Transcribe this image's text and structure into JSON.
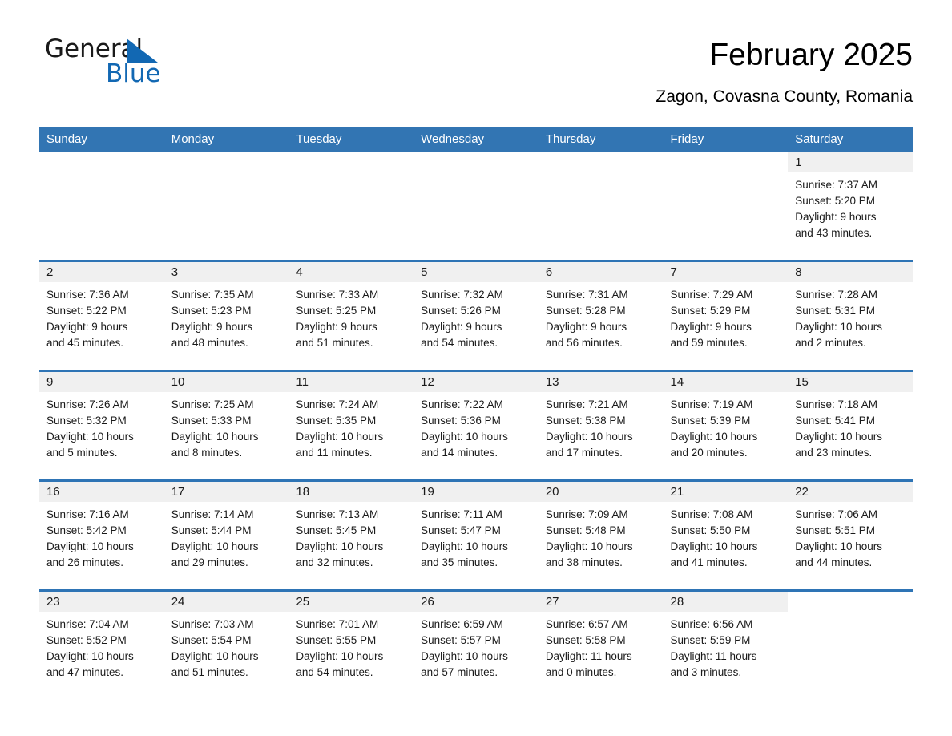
{
  "brand": {
    "name_part1": "General",
    "name_part2": "Blue",
    "logo_icon": "triangle-icon",
    "accent_color": "#1268b3"
  },
  "header": {
    "title": "February 2025",
    "subtitle": "Zagon, Covasna County, Romania"
  },
  "calendar": {
    "header_bg": "#3275b3",
    "row_border_color": "#2e74b5",
    "daynum_bg": "#f0f0f0",
    "weekdays": [
      "Sunday",
      "Monday",
      "Tuesday",
      "Wednesday",
      "Thursday",
      "Friday",
      "Saturday"
    ],
    "weeks": [
      [
        {
          "day": "",
          "blank": true
        },
        {
          "day": "",
          "blank": true
        },
        {
          "day": "",
          "blank": true
        },
        {
          "day": "",
          "blank": true
        },
        {
          "day": "",
          "blank": true
        },
        {
          "day": "",
          "blank": true
        },
        {
          "day": "1",
          "sunrise": "Sunrise: 7:37 AM",
          "sunset": "Sunset: 5:20 PM",
          "daylight1": "Daylight: 9 hours",
          "daylight2": "and 43 minutes."
        }
      ],
      [
        {
          "day": "2",
          "sunrise": "Sunrise: 7:36 AM",
          "sunset": "Sunset: 5:22 PM",
          "daylight1": "Daylight: 9 hours",
          "daylight2": "and 45 minutes."
        },
        {
          "day": "3",
          "sunrise": "Sunrise: 7:35 AM",
          "sunset": "Sunset: 5:23 PM",
          "daylight1": "Daylight: 9 hours",
          "daylight2": "and 48 minutes."
        },
        {
          "day": "4",
          "sunrise": "Sunrise: 7:33 AM",
          "sunset": "Sunset: 5:25 PM",
          "daylight1": "Daylight: 9 hours",
          "daylight2": "and 51 minutes."
        },
        {
          "day": "5",
          "sunrise": "Sunrise: 7:32 AM",
          "sunset": "Sunset: 5:26 PM",
          "daylight1": "Daylight: 9 hours",
          "daylight2": "and 54 minutes."
        },
        {
          "day": "6",
          "sunrise": "Sunrise: 7:31 AM",
          "sunset": "Sunset: 5:28 PM",
          "daylight1": "Daylight: 9 hours",
          "daylight2": "and 56 minutes."
        },
        {
          "day": "7",
          "sunrise": "Sunrise: 7:29 AM",
          "sunset": "Sunset: 5:29 PM",
          "daylight1": "Daylight: 9 hours",
          "daylight2": "and 59 minutes."
        },
        {
          "day": "8",
          "sunrise": "Sunrise: 7:28 AM",
          "sunset": "Sunset: 5:31 PM",
          "daylight1": "Daylight: 10 hours",
          "daylight2": "and 2 minutes."
        }
      ],
      [
        {
          "day": "9",
          "sunrise": "Sunrise: 7:26 AM",
          "sunset": "Sunset: 5:32 PM",
          "daylight1": "Daylight: 10 hours",
          "daylight2": "and 5 minutes."
        },
        {
          "day": "10",
          "sunrise": "Sunrise: 7:25 AM",
          "sunset": "Sunset: 5:33 PM",
          "daylight1": "Daylight: 10 hours",
          "daylight2": "and 8 minutes."
        },
        {
          "day": "11",
          "sunrise": "Sunrise: 7:24 AM",
          "sunset": "Sunset: 5:35 PM",
          "daylight1": "Daylight: 10 hours",
          "daylight2": "and 11 minutes."
        },
        {
          "day": "12",
          "sunrise": "Sunrise: 7:22 AM",
          "sunset": "Sunset: 5:36 PM",
          "daylight1": "Daylight: 10 hours",
          "daylight2": "and 14 minutes."
        },
        {
          "day": "13",
          "sunrise": "Sunrise: 7:21 AM",
          "sunset": "Sunset: 5:38 PM",
          "daylight1": "Daylight: 10 hours",
          "daylight2": "and 17 minutes."
        },
        {
          "day": "14",
          "sunrise": "Sunrise: 7:19 AM",
          "sunset": "Sunset: 5:39 PM",
          "daylight1": "Daylight: 10 hours",
          "daylight2": "and 20 minutes."
        },
        {
          "day": "15",
          "sunrise": "Sunrise: 7:18 AM",
          "sunset": "Sunset: 5:41 PM",
          "daylight1": "Daylight: 10 hours",
          "daylight2": "and 23 minutes."
        }
      ],
      [
        {
          "day": "16",
          "sunrise": "Sunrise: 7:16 AM",
          "sunset": "Sunset: 5:42 PM",
          "daylight1": "Daylight: 10 hours",
          "daylight2": "and 26 minutes."
        },
        {
          "day": "17",
          "sunrise": "Sunrise: 7:14 AM",
          "sunset": "Sunset: 5:44 PM",
          "daylight1": "Daylight: 10 hours",
          "daylight2": "and 29 minutes."
        },
        {
          "day": "18",
          "sunrise": "Sunrise: 7:13 AM",
          "sunset": "Sunset: 5:45 PM",
          "daylight1": "Daylight: 10 hours",
          "daylight2": "and 32 minutes."
        },
        {
          "day": "19",
          "sunrise": "Sunrise: 7:11 AM",
          "sunset": "Sunset: 5:47 PM",
          "daylight1": "Daylight: 10 hours",
          "daylight2": "and 35 minutes."
        },
        {
          "day": "20",
          "sunrise": "Sunrise: 7:09 AM",
          "sunset": "Sunset: 5:48 PM",
          "daylight1": "Daylight: 10 hours",
          "daylight2": "and 38 minutes."
        },
        {
          "day": "21",
          "sunrise": "Sunrise: 7:08 AM",
          "sunset": "Sunset: 5:50 PM",
          "daylight1": "Daylight: 10 hours",
          "daylight2": "and 41 minutes."
        },
        {
          "day": "22",
          "sunrise": "Sunrise: 7:06 AM",
          "sunset": "Sunset: 5:51 PM",
          "daylight1": "Daylight: 10 hours",
          "daylight2": "and 44 minutes."
        }
      ],
      [
        {
          "day": "23",
          "sunrise": "Sunrise: 7:04 AM",
          "sunset": "Sunset: 5:52 PM",
          "daylight1": "Daylight: 10 hours",
          "daylight2": "and 47 minutes."
        },
        {
          "day": "24",
          "sunrise": "Sunrise: 7:03 AM",
          "sunset": "Sunset: 5:54 PM",
          "daylight1": "Daylight: 10 hours",
          "daylight2": "and 51 minutes."
        },
        {
          "day": "25",
          "sunrise": "Sunrise: 7:01 AM",
          "sunset": "Sunset: 5:55 PM",
          "daylight1": "Daylight: 10 hours",
          "daylight2": "and 54 minutes."
        },
        {
          "day": "26",
          "sunrise": "Sunrise: 6:59 AM",
          "sunset": "Sunset: 5:57 PM",
          "daylight1": "Daylight: 10 hours",
          "daylight2": "and 57 minutes."
        },
        {
          "day": "27",
          "sunrise": "Sunrise: 6:57 AM",
          "sunset": "Sunset: 5:58 PM",
          "daylight1": "Daylight: 11 hours",
          "daylight2": "and 0 minutes."
        },
        {
          "day": "28",
          "sunrise": "Sunrise: 6:56 AM",
          "sunset": "Sunset: 5:59 PM",
          "daylight1": "Daylight: 11 hours",
          "daylight2": "and 3 minutes."
        },
        {
          "day": "",
          "blank": true
        }
      ]
    ]
  }
}
